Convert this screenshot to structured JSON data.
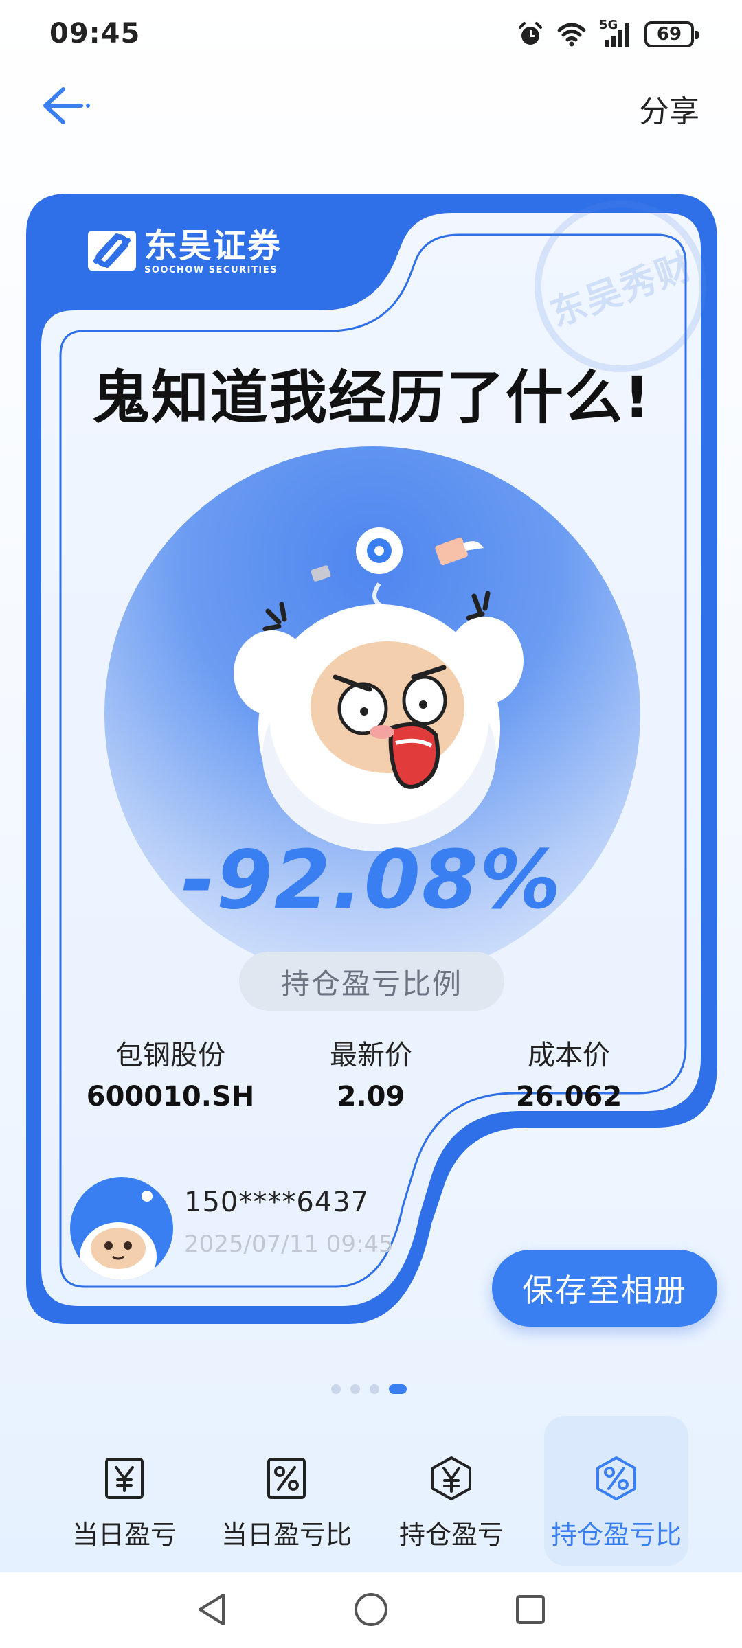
{
  "status_bar": {
    "time": "09:45",
    "battery": "69",
    "network": "5G",
    "icons": [
      "alarm-icon",
      "wifi-icon",
      "signal-icon",
      "battery-icon"
    ]
  },
  "nav": {
    "back_icon": "back-arrow-icon",
    "share_label": "分享"
  },
  "card": {
    "brand_cn": "东吴证券",
    "brand_en": "SOOCHOW SECURITIES",
    "stamp_text": "东吴秀财",
    "headline": "鬼知道我经历了什么!",
    "percent_value": "-92.08%",
    "percent_label": "持仓盈亏比例",
    "stock": {
      "name": "包钢股份",
      "code": "600010.SH",
      "latest_price_label": "最新价",
      "latest_price": "2.09",
      "cost_price_label": "成本价",
      "cost_price": "26.062"
    },
    "account": {
      "phone": "150****6437",
      "datetime": "2025/07/11 09:45"
    }
  },
  "save_button": "保存至相册",
  "pager": {
    "count": 4,
    "active_index": 3
  },
  "tabs": [
    {
      "label": "当日盈亏",
      "icon": "yuan-square-icon",
      "active": false
    },
    {
      "label": "当日盈亏比",
      "icon": "percent-square-icon",
      "active": false
    },
    {
      "label": "持仓盈亏",
      "icon": "yuan-hexagon-icon",
      "active": false
    },
    {
      "label": "持仓盈亏比",
      "icon": "percent-hexagon-icon",
      "active": true
    }
  ],
  "system_nav": [
    "back-triangle-icon",
    "home-circle-icon",
    "recents-square-icon"
  ],
  "colors": {
    "accent": "#3a7ff2",
    "card_border": "#2f6fe8",
    "label_bg": "#dfe7f1",
    "active_tab_bg": "#dbe9fc"
  }
}
